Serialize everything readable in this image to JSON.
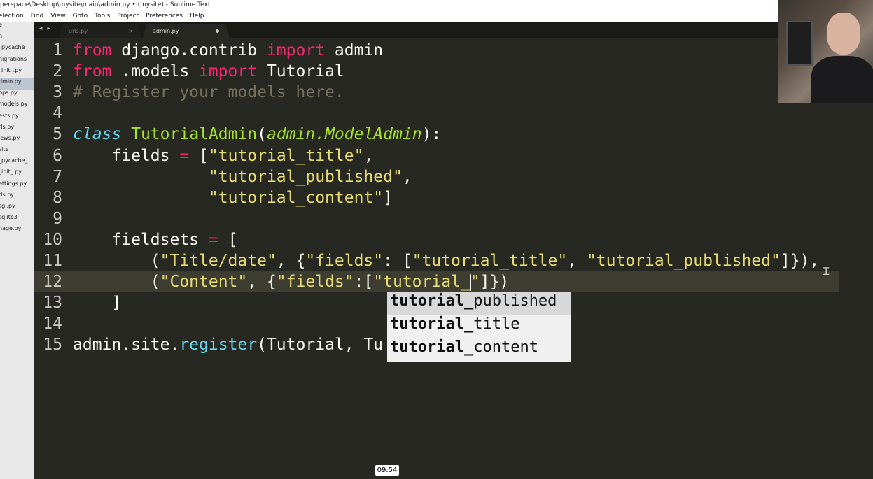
{
  "window": {
    "title": "perspace\\Desktop\\mysite\\main\\admin.py • (mysite) - Sublime Text"
  },
  "menu": [
    "election",
    "Find",
    "View",
    "Goto",
    "Tools",
    "Project",
    "Preferences",
    "Help"
  ],
  "sidebar": {
    "items": [
      {
        "label": "e"
      },
      {
        "label": "n"
      },
      {
        "label": "_pycache_"
      },
      {
        "label": "nigrations"
      },
      {
        "label": "_init_.py"
      },
      {
        "label": "dmin.py"
      },
      {
        "label": "pps.py"
      },
      {
        "label": "models.py"
      },
      {
        "label": "ests.py"
      },
      {
        "label": "rls.py"
      },
      {
        "label": "iews.py"
      },
      {
        "label": "site"
      },
      {
        "label": "_pycache_"
      },
      {
        "label": "_init_.py"
      },
      {
        "label": "ettings.py"
      },
      {
        "label": "rls.py"
      },
      {
        "label": "sgi.py"
      },
      {
        "label": "sqlite3"
      },
      {
        "label": "nage.py"
      }
    ]
  },
  "tabs": [
    {
      "label": "urls.py",
      "close": "×"
    },
    {
      "label": "admin.py"
    }
  ],
  "nav_arrows": "◂ ▸",
  "editor": {
    "lines": [
      {
        "num": "1",
        "tokens": [
          {
            "t": "from",
            "c": "k"
          },
          {
            "t": " django.contrib ",
            "c": ""
          },
          {
            "t": "import",
            "c": "k"
          },
          {
            "t": " admin",
            "c": ""
          }
        ]
      },
      {
        "num": "2",
        "tokens": [
          {
            "t": "from",
            "c": "k"
          },
          {
            "t": " .models ",
            "c": ""
          },
          {
            "t": "import",
            "c": "k"
          },
          {
            "t": " Tutorial",
            "c": ""
          }
        ]
      },
      {
        "num": "3",
        "tokens": [
          {
            "t": "# Register your models here.",
            "c": "c"
          }
        ]
      },
      {
        "num": "4",
        "tokens": []
      },
      {
        "num": "5",
        "tokens": [
          {
            "t": "class",
            "c": "kc"
          },
          {
            "t": " ",
            "c": ""
          },
          {
            "t": "TutorialAdmin",
            "c": "cls"
          },
          {
            "t": "(",
            "c": ""
          },
          {
            "t": "admin.ModelAdmin",
            "c": "inh"
          },
          {
            "t": "):",
            "c": ""
          }
        ]
      },
      {
        "num": "6",
        "tokens": [
          {
            "t": "    fields ",
            "c": ""
          },
          {
            "t": "=",
            "c": "k"
          },
          {
            "t": " [",
            "c": ""
          },
          {
            "t": "\"tutorial_title\"",
            "c": "s"
          },
          {
            "t": ",",
            "c": ""
          }
        ]
      },
      {
        "num": "7",
        "tokens": [
          {
            "t": "              ",
            "c": ""
          },
          {
            "t": "\"tutorial_published\"",
            "c": "s"
          },
          {
            "t": ",",
            "c": ""
          }
        ]
      },
      {
        "num": "8",
        "tokens": [
          {
            "t": "              ",
            "c": ""
          },
          {
            "t": "\"tutorial_content\"",
            "c": "s"
          },
          {
            "t": "]",
            "c": ""
          }
        ]
      },
      {
        "num": "9",
        "tokens": []
      },
      {
        "num": "10",
        "tokens": [
          {
            "t": "    fieldsets ",
            "c": ""
          },
          {
            "t": "=",
            "c": "k"
          },
          {
            "t": " [",
            "c": ""
          }
        ]
      },
      {
        "num": "11",
        "tokens": [
          {
            "t": "        (",
            "c": ""
          },
          {
            "t": "\"Title/date\"",
            "c": "s"
          },
          {
            "t": ", {",
            "c": ""
          },
          {
            "t": "\"fields\"",
            "c": "s"
          },
          {
            "t": ": [",
            "c": ""
          },
          {
            "t": "\"tutorial_title\"",
            "c": "s"
          },
          {
            "t": ", ",
            "c": ""
          },
          {
            "t": "\"tutorial_published\"",
            "c": "s"
          },
          {
            "t": "]}),",
            "c": ""
          }
        ]
      },
      {
        "num": "12",
        "cur": true,
        "tokens": [
          {
            "t": "        (",
            "c": ""
          },
          {
            "t": "\"Content\"",
            "c": "s"
          },
          {
            "t": ", {",
            "c": ""
          },
          {
            "t": "\"fields\"",
            "c": "s"
          },
          {
            "t": ":[",
            "c": ""
          },
          {
            "t": "\"tutorial_",
            "c": "s"
          },
          {
            "t": "CARET",
            "c": "caret"
          },
          {
            "t": "\"",
            "c": "s"
          },
          {
            "t": "]})",
            "c": ""
          }
        ]
      },
      {
        "num": "13",
        "tokens": [
          {
            "t": "    ]",
            "c": ""
          }
        ]
      },
      {
        "num": "14",
        "tokens": []
      },
      {
        "num": "15",
        "tokens": [
          {
            "t": "admin.site.",
            "c": ""
          },
          {
            "t": "register",
            "c": "f"
          },
          {
            "t": "(Tutorial, Tu",
            "c": ""
          }
        ]
      }
    ]
  },
  "autocomplete": {
    "options": [
      {
        "match": "tutorial_",
        "rest": "published",
        "selected": true
      },
      {
        "match": "tutorial_",
        "rest": "title"
      },
      {
        "match": "tutorial_",
        "rest": "content"
      }
    ]
  },
  "video": {
    "timestamp": "09:54"
  },
  "colors": {
    "background": "#272822",
    "keyword": "#f92672",
    "string": "#e6db74",
    "comment": "#75715e",
    "class": "#a6e22e",
    "storage": "#66d9ef"
  }
}
